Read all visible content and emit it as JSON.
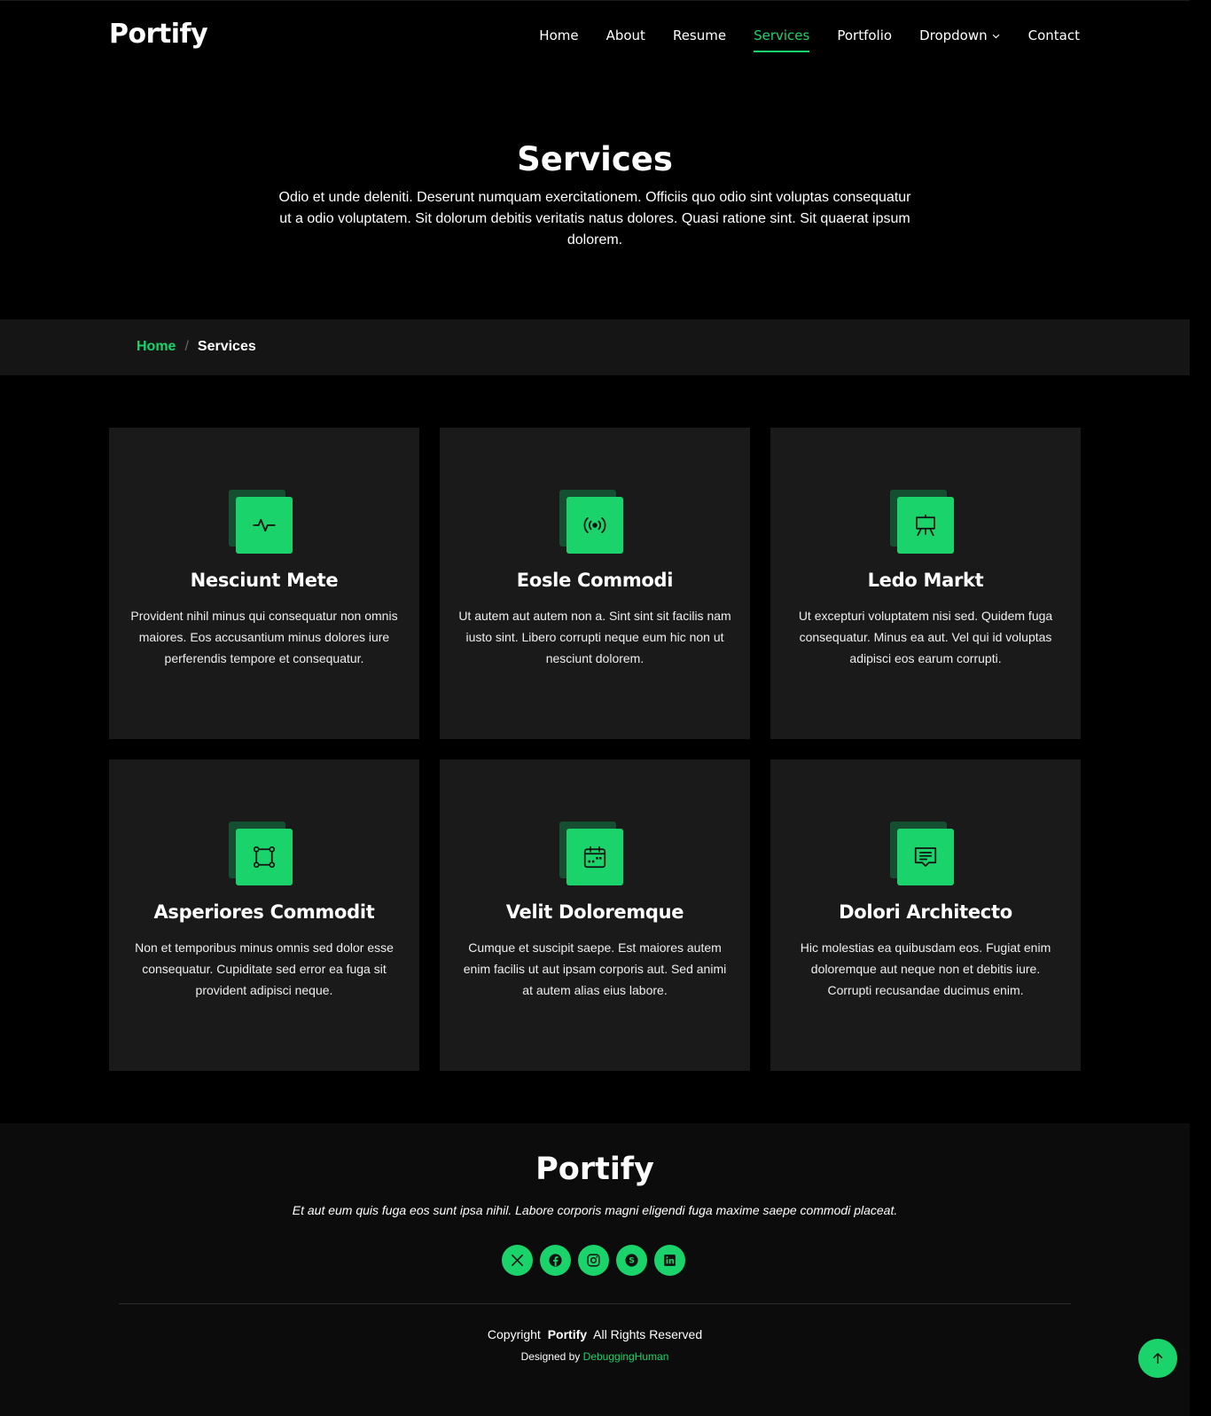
{
  "brand": {
    "name": "Portify",
    "accent_color": "#1ad46b"
  },
  "nav": {
    "items": [
      {
        "label": "Home"
      },
      {
        "label": "About"
      },
      {
        "label": "Resume"
      },
      {
        "label": "Services",
        "active": true
      },
      {
        "label": "Portfolio"
      },
      {
        "label": "Dropdown",
        "has_chevron": true
      },
      {
        "label": "Contact"
      }
    ]
  },
  "hero": {
    "title": "Services",
    "description": "Odio et unde deleniti. Deserunt numquam exercitationem. Officiis quo odio sint voluptas consequatur ut a odio voluptatem. Sit dolorum debitis veritatis natus dolores. Quasi ratione sint. Sit quaerat ipsum dolorem."
  },
  "breadcrumb": {
    "home": "Home",
    "separator": "/",
    "current": "Services"
  },
  "services": [
    {
      "icon": "activity-icon",
      "title": "Nesciunt Mete",
      "description": "Provident nihil minus qui consequatur non omnis maiores. Eos accusantium minus dolores iure perferendis tempore et consequatur."
    },
    {
      "icon": "broadcast-icon",
      "title": "Eosle Commodi",
      "description": "Ut autem aut autem non a. Sint sint sit facilis nam iusto sint. Libero corrupti neque eum hic non ut nesciunt dolorem."
    },
    {
      "icon": "easel-icon",
      "title": "Ledo Markt",
      "description": "Ut excepturi voluptatem nisi sed. Quidem fuga consequatur. Minus ea aut. Vel qui id voluptas adipisci eos earum corrupti."
    },
    {
      "icon": "bounding-box-icon",
      "title": "Asperiores Commodit",
      "description": "Non et temporibus minus omnis sed dolor esse consequatur. Cupiditate sed error ea fuga sit provident adipisci neque."
    },
    {
      "icon": "calendar-icon",
      "title": "Velit Doloremque",
      "description": "Cumque et suscipit saepe. Est maiores autem enim facilis ut aut ipsam corporis aut. Sed animi at autem alias eius labore."
    },
    {
      "icon": "chat-square-text-icon",
      "title": "Dolori Architecto",
      "description": "Hic molestias ea quibusdam eos. Fugiat enim doloremque aut neque non et debitis iure. Corrupti recusandae ducimus enim."
    }
  ],
  "footer": {
    "logo": "Portify",
    "tagline": "Et aut eum quis fuga eos sunt ipsa nihil. Labore corporis magni eligendi fuga maxime saepe commodi placeat.",
    "socials": [
      "x-icon",
      "facebook-icon",
      "instagram-icon",
      "skype-icon",
      "linkedin-icon"
    ],
    "copyright_prefix": "Copyright",
    "copyright_brand": "Portify",
    "copyright_suffix": "All Rights Reserved",
    "designed_prefix": "Designed by",
    "designed_by": "DebuggingHuman"
  }
}
